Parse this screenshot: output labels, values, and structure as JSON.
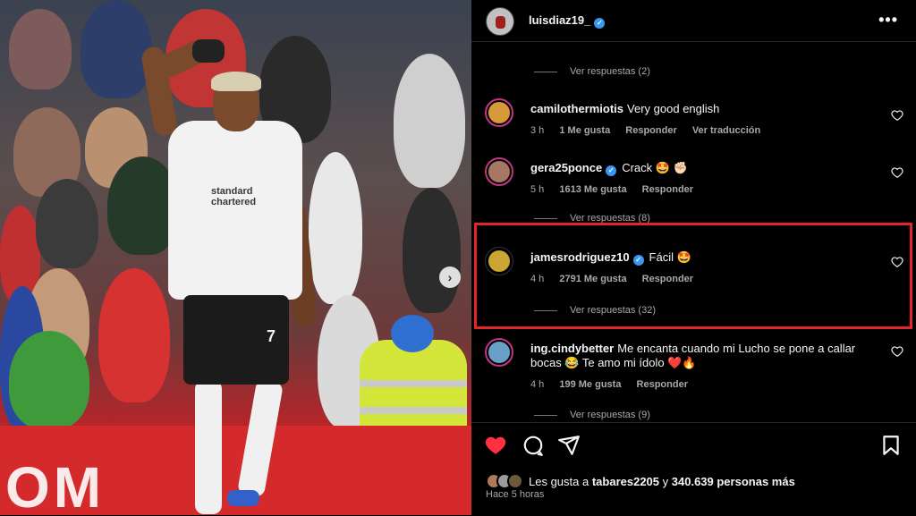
{
  "post": {
    "username": "luisdiaz19_",
    "verified_mark": "✓",
    "more_label": "•••",
    "photo": {
      "banner_text": "OM",
      "sponsor_line1": "standard",
      "sponsor_line2": "chartered",
      "shirt_number": "7",
      "next_glyph": "›"
    }
  },
  "comments": [
    {
      "kind": "replies",
      "label": "Ver respuestas (2)"
    },
    {
      "username": "camilothermiotis",
      "verified": false,
      "text": "Very good english",
      "time": "3 h",
      "likes": "1 Me gusta",
      "reply": "Responder",
      "translate": "Ver traducción",
      "avatar_color": "#d79a3a"
    },
    {
      "username": "gera25ponce",
      "verified": true,
      "text": "Crack 🤩 ✊🏻",
      "time": "5 h",
      "likes": "1613 Me gusta",
      "reply": "Responder",
      "avatar_color": "#a77766"
    },
    {
      "kind": "replies",
      "label": "Ver respuestas (8)"
    },
    {
      "username": "jamesrodriguez10",
      "verified": true,
      "text": "Fácil 🤩",
      "time": "4 h",
      "likes": "2791 Me gusta",
      "reply": "Responder",
      "avatar_color": "#c9a531",
      "replies": "Ver respuestas (32)"
    },
    {
      "username": "ing.cindybetter",
      "verified": false,
      "text": "Me encanta cuando mi Lucho se pone a callar bocas 😂 Te amo mi ídolo ❤️🔥",
      "time": "4 h",
      "likes": "199 Me gusta",
      "reply": "Responder",
      "avatar_color": "#6aa0c8",
      "replies": "Ver respuestas (9)"
    }
  ],
  "footer": {
    "liked_by_prefix": "Les gusta a",
    "liked_by_user": "tabares2205",
    "liked_by_suffix": "y",
    "liked_count": "340.639 personas más",
    "posted_ago": "Hace 5 horas"
  },
  "colors": {
    "accent_red": "#ff3040",
    "highlight_box": "#e0262b",
    "verified_blue": "#3897f0",
    "muted_text": "#a8a8a8"
  },
  "icons": [
    "heart-filled-icon",
    "comment-icon",
    "share-icon",
    "bookmark-icon",
    "heart-outline-icon",
    "more-icon",
    "verified-icon",
    "next-arrow-icon"
  ]
}
